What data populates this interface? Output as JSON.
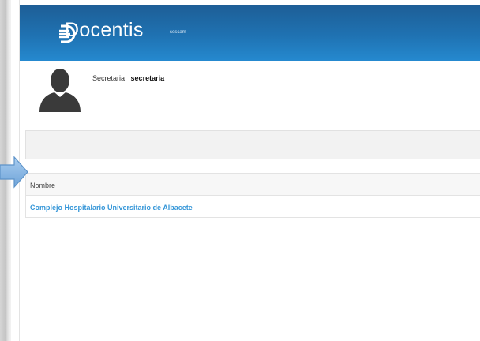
{
  "header": {
    "brand": "Docentis",
    "tenant": "sescam",
    "colors": {
      "header_top": "#1e5e96",
      "header_bottom": "#2589cf"
    }
  },
  "user": {
    "role": "Secretaria",
    "username": "secretaria",
    "avatar_icon": "user-silhouette-icon"
  },
  "table": {
    "columns": [
      "Nombre"
    ],
    "rows": [
      {
        "nombre": "Complejo Hospitalario Universitario de Albacete"
      }
    ],
    "link_color": "#3596d8"
  },
  "callout": {
    "icon": "arrow-right-icon",
    "color": "#7fb2e0"
  }
}
